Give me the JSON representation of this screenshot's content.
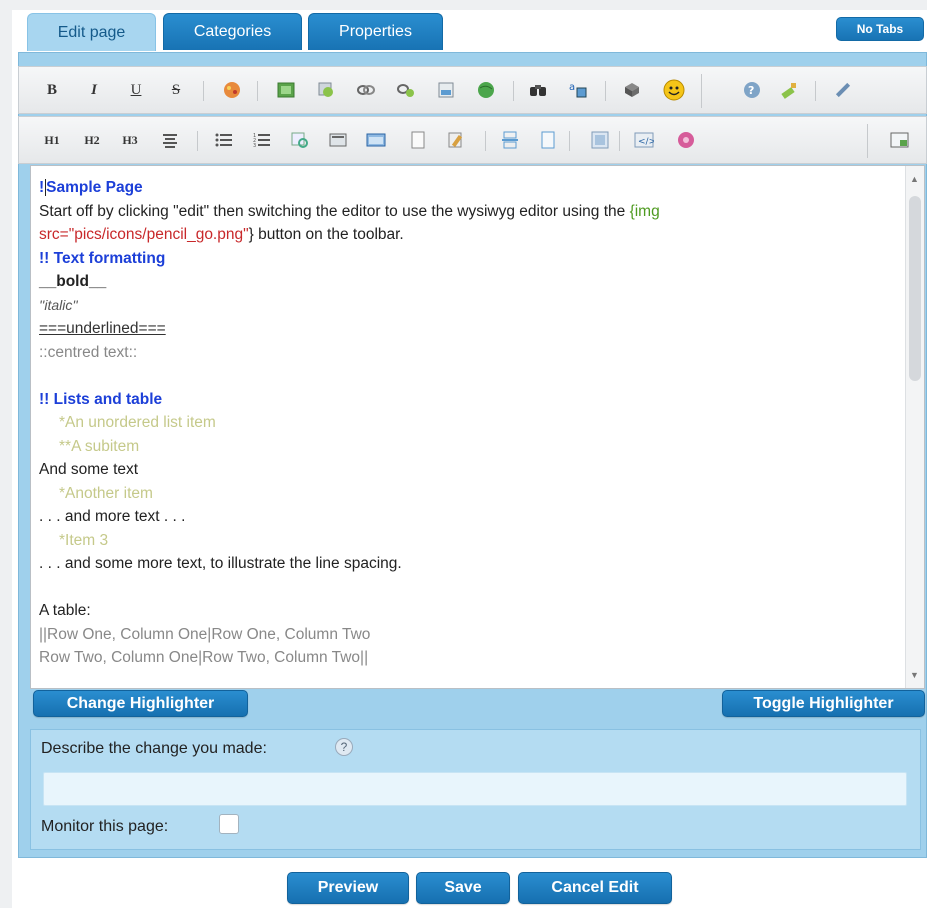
{
  "tabs": [
    {
      "label": "Edit page",
      "active": true
    },
    {
      "label": "Categories",
      "active": false
    },
    {
      "label": "Properties",
      "active": false
    }
  ],
  "no_tabs_label": "No Tabs",
  "toolbar1": {
    "bold": "B",
    "italic": "I",
    "underline": "U",
    "strike": "S"
  },
  "toolbar2": {
    "h1": "H1",
    "h2": "H2",
    "h3": "H3"
  },
  "editor": {
    "line1": {
      "marker": "!",
      "text": "Sample Page"
    },
    "line2": {
      "prefix": "Start off by clicking \"edit\" then switching the editor to use the wysiwyg editor using the ",
      "green": "{img"
    },
    "line3": {
      "red": "src=\"pics/icons/pencil_go.png\"",
      "suffix": "} button on the toolbar."
    },
    "line4": "!! Text formatting",
    "line5": "__bold__",
    "line6": "''italic''",
    "line7": "===underlined===",
    "line8": "::centred text::",
    "line9": "",
    "line10": "!! Lists and table",
    "line11": "*An unordered list item",
    "line12": "**A subitem",
    "line13": "And some text",
    "line14": "*Another item",
    "line15": ". . . and more text . . .",
    "line16": "*Item 3",
    "line17": ". . . and some more text, to illustrate the line spacing.",
    "line18": "",
    "line19": "A table:",
    "line20": "||Row One, Column One|Row One, Column Two",
    "line21": "Row Two, Column One|Row Two, Column Two||"
  },
  "buttons": {
    "change_highlighter": "Change Highlighter",
    "toggle_highlighter": "Toggle Highlighter",
    "preview": "Preview",
    "save": "Save",
    "cancel": "Cancel Edit"
  },
  "describe_label": "Describe the change you made:",
  "monitor_label": "Monitor this page:",
  "colors": {
    "tab_blue": "#1873b4",
    "active_tab": "#a8d6f0",
    "panel_blue": "#9fd0ec",
    "heading_blue": "#1c3fd8",
    "plugin_green": "#4e9a20",
    "plugin_red": "#c8282a"
  }
}
